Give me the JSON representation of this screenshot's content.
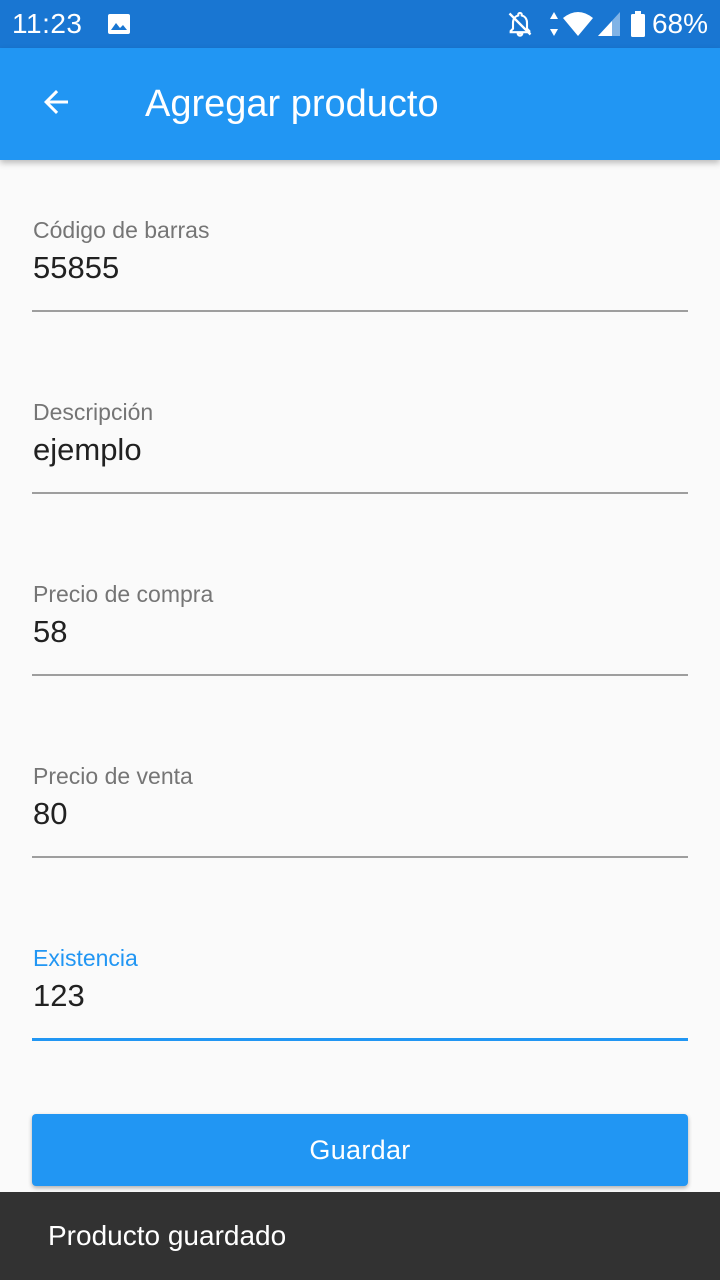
{
  "status_bar": {
    "time": "11:23",
    "battery_percent": "68%",
    "icons": [
      "image-icon",
      "notifications-off-icon",
      "data-arrows-icon",
      "wifi-icon",
      "cell-signal-icon",
      "battery-icon"
    ]
  },
  "app_bar": {
    "title": "Agregar producto",
    "back_icon": "arrow-back-icon",
    "background_color": "#2196f3"
  },
  "form": {
    "fields": [
      {
        "label": "Código de barras",
        "value": "55855"
      },
      {
        "label": "Descripción",
        "value": "ejemplo"
      },
      {
        "label": "Precio de compra",
        "value": "58"
      },
      {
        "label": "Precio de venta",
        "value": "80"
      },
      {
        "label": "Existencia",
        "value": "123",
        "focused": true
      }
    ],
    "save_label": "Guardar",
    "accent_color": "#2196f3"
  },
  "snackbar": {
    "message": "Producto guardado"
  }
}
